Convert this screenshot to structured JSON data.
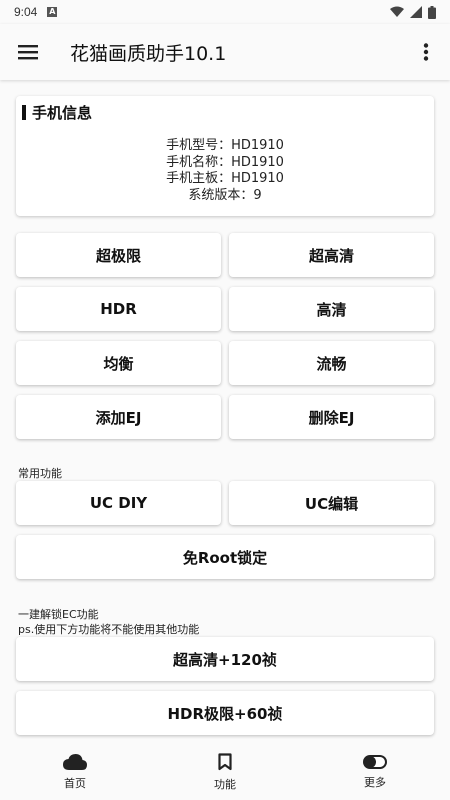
{
  "status_bar": {
    "time": "9:04",
    "badge": "A"
  },
  "app_bar": {
    "title": "花猫画质助手10.1"
  },
  "phone_info": {
    "heading": "手机信息",
    "lines": [
      "手机型号：HD1910",
      "手机名称：HD1910",
      "手机主板：HD1910",
      "系统版本：9"
    ]
  },
  "quality_buttons": {
    "super_limit": "超极限",
    "ultra_hd": "超高清",
    "hdr": "HDR",
    "hd": "高清",
    "balanced": "均衡",
    "smooth": "流畅",
    "add_ej": "添加EJ",
    "delete_ej": "删除EJ"
  },
  "common": {
    "label": "常用功能",
    "uc_diy": "UC DIY",
    "uc_edit": "UC编辑",
    "no_root_lock": "免Root锁定"
  },
  "unlock": {
    "label": "一建解锁EC功能",
    "note": "ps.使用下方功能将不能使用其他功能",
    "ultra_hd_120": "超高清+120祯",
    "hdr_limit_60": "HDR极限+60祯"
  },
  "bottom_nav": {
    "home": "首页",
    "features": "功能",
    "more": "更多"
  }
}
